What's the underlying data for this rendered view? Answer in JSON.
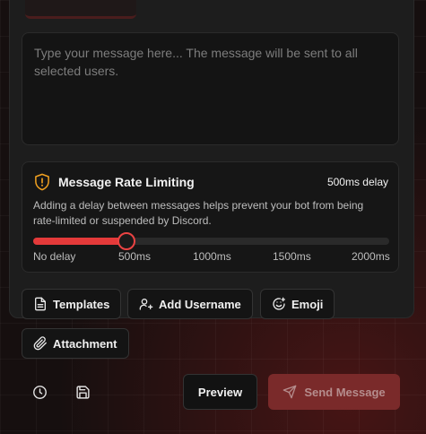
{
  "composer": {
    "placeholder": "Type your message here... The message will be sent to all selected users."
  },
  "rate_limiting": {
    "title": "Message Rate Limiting",
    "value_label": "500ms delay",
    "description": "Adding a delay between messages helps prevent your bot from being rate-limited or suspended by Discord.",
    "slider": {
      "min_ms": 0,
      "max_ms": 2000,
      "value_ms": 500,
      "ticks": [
        "No delay",
        "500ms",
        "1000ms",
        "1500ms",
        "2000ms"
      ]
    },
    "icon": "shield-alert-icon",
    "accent_color": "#f0a020"
  },
  "toolbar": {
    "templates_label": "Templates",
    "add_username_label": "Add Username",
    "emoji_label": "Emoji",
    "attachment_label": "Attachment"
  },
  "footer": {
    "history_icon": "clock-icon",
    "save_icon": "save-icon",
    "preview_label": "Preview",
    "send_label": "Send Message",
    "send_color": "#7a2a2a"
  }
}
